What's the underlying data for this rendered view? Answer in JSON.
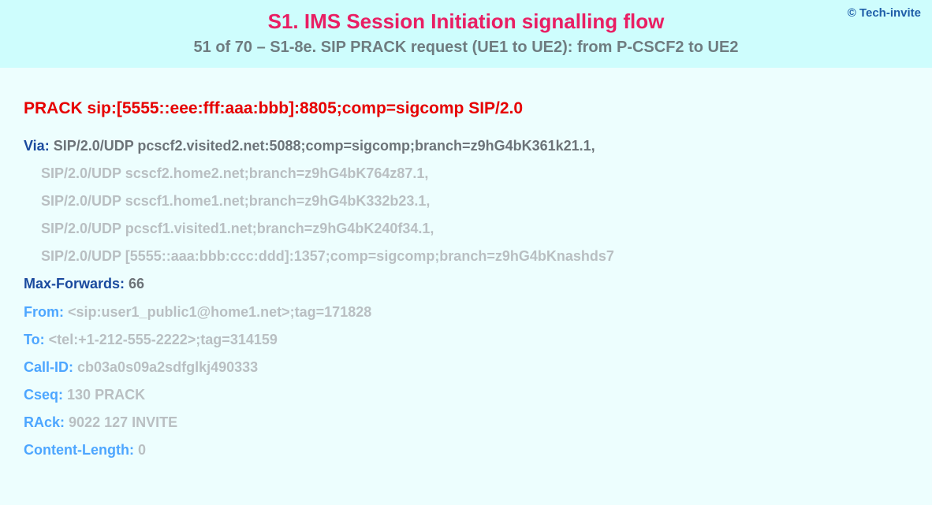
{
  "copyright": "© Tech-invite",
  "title": "S1. IMS Session Initiation signalling flow",
  "subtitle": "51 of 70 – S1-8e. SIP PRACK request (UE1 to UE2): from P-CSCF2 to UE2",
  "sip": {
    "method": "PRACK",
    "request_uri": "sip:[5555::eee:fff:aaa:bbb]:8805;comp=sigcomp SIP/2.0",
    "via": {
      "label": "Via:",
      "first": "SIP/2.0/UDP pcscf2.visited2.net:5088;comp=sigcomp;branch=z9hG4bK361k21.1,",
      "cont": [
        "SIP/2.0/UDP scscf2.home2.net;branch=z9hG4bK764z87.1,",
        "SIP/2.0/UDP scscf1.home1.net;branch=z9hG4bK332b23.1,",
        "SIP/2.0/UDP pcscf1.visited1.net;branch=z9hG4bK240f34.1,",
        "SIP/2.0/UDP [5555::aaa:bbb:ccc:ddd]:1357;comp=sigcomp;branch=z9hG4bKnashds7"
      ]
    },
    "max_forwards": {
      "label": "Max-Forwards:",
      "value": "66"
    },
    "from": {
      "label": "From:",
      "value": "<sip:user1_public1@home1.net>;tag=171828"
    },
    "to": {
      "label": "To:",
      "value": "<tel:+1-212-555-2222>;tag=314159"
    },
    "call_id": {
      "label": "Call-ID:",
      "value": "cb03a0s09a2sdfglkj490333"
    },
    "cseq": {
      "label": "Cseq:",
      "value": "130 PRACK"
    },
    "rack": {
      "label": "RAck:",
      "value": "9022 127 INVITE"
    },
    "content_length": {
      "label": "Content-Length:",
      "value": "0"
    }
  }
}
